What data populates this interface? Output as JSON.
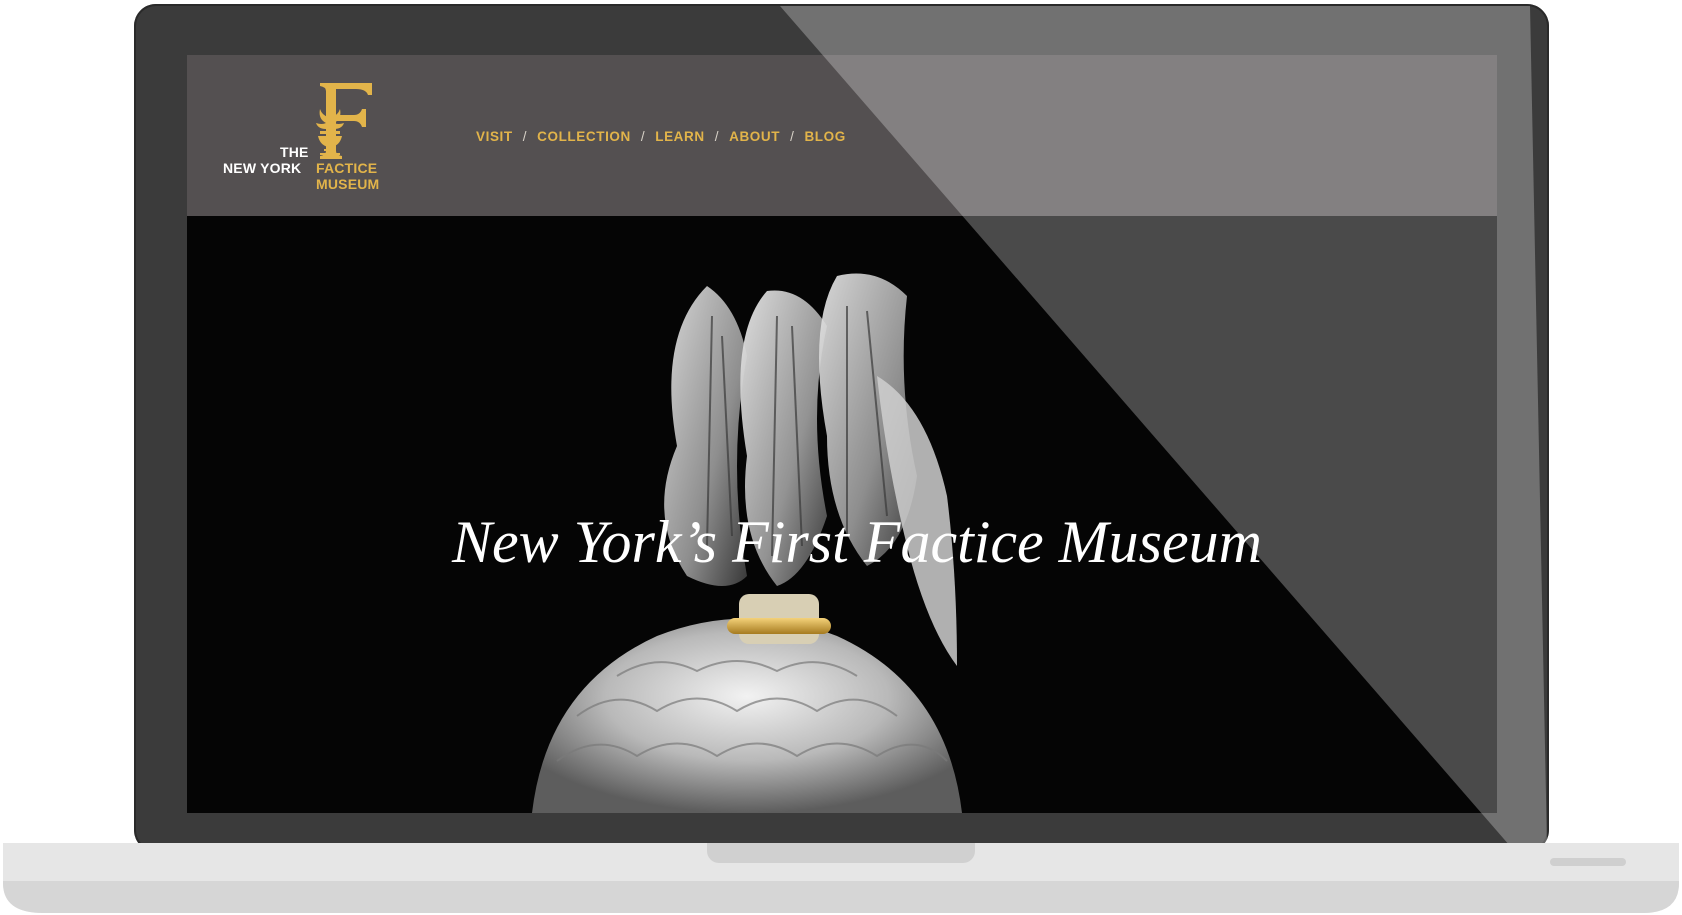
{
  "logo": {
    "the": "THE",
    "new_york": "NEW YORK",
    "factice": "FACTICE",
    "museum": "MUSEUM",
    "monogram_letter": "F"
  },
  "nav": {
    "items": [
      {
        "label": "VISIT"
      },
      {
        "label": "COLLECTION"
      },
      {
        "label": "LEARN"
      },
      {
        "label": "ABOUT"
      },
      {
        "label": "BLOG"
      }
    ],
    "separator": "/"
  },
  "hero": {
    "title": "New York’s First Factice Museum"
  },
  "colors": {
    "accent_gold": "#e2b44a",
    "header_bg": "#545051",
    "hero_bg": "#000000"
  }
}
